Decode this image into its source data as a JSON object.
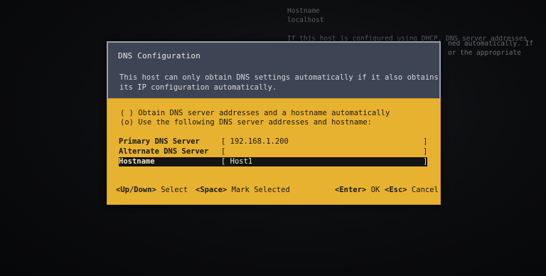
{
  "background": {
    "lines": [
      "Hostname",
      "localhost",
      "",
      "If this host is configured using DHCP, DNS server addresses"
    ],
    "right_lines": [
      "ned automatically. If",
      "or the appropriate"
    ]
  },
  "dialog": {
    "title": "DNS Configuration",
    "description_line1": "This host can only obtain DNS settings automatically if it also obtains",
    "description_line2": "its IP configuration automatically.",
    "options": [
      {
        "label": "( ) Obtain DNS server addresses and a hostname automatically"
      },
      {
        "label": "(o) Use the following DNS server addresses and hostname:"
      }
    ],
    "fields": [
      {
        "label": "Primary DNS Server",
        "value": "[ 192.168.1.200",
        "end": "]"
      },
      {
        "label": "Alternate DNS Server",
        "value": "[",
        "end": "]"
      },
      {
        "label": "Hostname",
        "value": "[ Host1",
        "end": "]"
      }
    ],
    "hints": {
      "updown_key": "<Up/Down>",
      "updown_text": " Select",
      "space_key": "<Space>",
      "space_text": " Mark Selected",
      "enter_key": "<Enter>",
      "enter_text": " OK",
      "esc_key": "<Esc>",
      "esc_text": " Cancel"
    }
  },
  "colors": {
    "header_bg": "#3d4454",
    "body_bg": "#e8b231",
    "selected_row_bg": "#141414"
  }
}
